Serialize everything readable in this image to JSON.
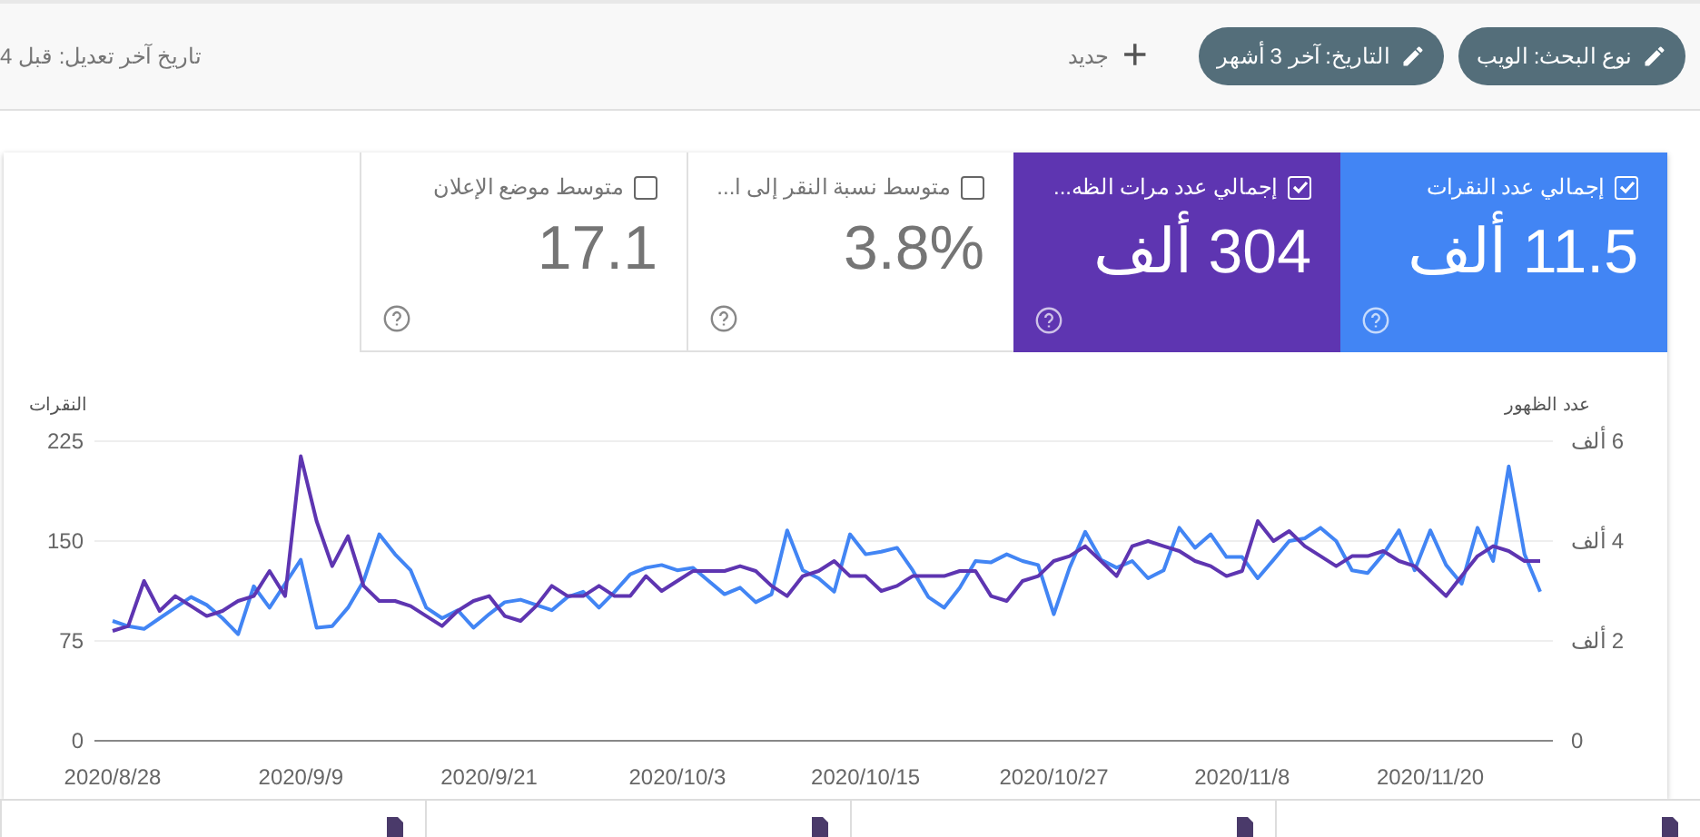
{
  "toolbar": {
    "chips": [
      {
        "label": "نوع البحث: الويب"
      },
      {
        "label": "التاريخ: آخر 3 أشهر"
      }
    ],
    "new_button": {
      "icon": "+",
      "label": "جديد"
    },
    "last_modified": "تاريخ آخر تعديل: قبل 4"
  },
  "metrics": [
    {
      "label": "إجمالي عدد النقرات",
      "value": "11.5 ألف",
      "checked": true,
      "color": "#4285f4"
    },
    {
      "label": "إجمالي عدد مرات الظه...",
      "value": "304 ألف",
      "checked": true,
      "color": "#5e35b1"
    },
    {
      "label": "متوسط نسبة النقر إلى ا...",
      "value": "3.8%",
      "checked": false
    },
    {
      "label": "متوسط موضع الإعلان",
      "value": "17.1",
      "checked": false
    }
  ],
  "chart": {
    "chart_data": {
      "type": "line",
      "ylabel": "النقرات",
      "y2label": "عدد الظهور",
      "ylim": [
        0,
        225
      ],
      "yticks": [
        0,
        75,
        150,
        225
      ],
      "y2lim": [
        0,
        6
      ],
      "y2ticks": [
        {
          "value": 0,
          "label": "0"
        },
        {
          "value": 2,
          "label": "2 ألف"
        },
        {
          "value": 4,
          "label": "4 ألف"
        },
        {
          "value": 6,
          "label": "6 ألف"
        }
      ],
      "categories": [
        "2020/8/28",
        null,
        null,
        null,
        null,
        null,
        null,
        null,
        null,
        null,
        null,
        null,
        "2020/9/9",
        null,
        null,
        null,
        null,
        null,
        null,
        null,
        null,
        null,
        null,
        null,
        "2020/9/21",
        null,
        null,
        null,
        null,
        null,
        null,
        null,
        null,
        null,
        null,
        null,
        "2020/10/3",
        null,
        null,
        null,
        null,
        null,
        null,
        null,
        null,
        null,
        null,
        null,
        "2020/10/15",
        null,
        null,
        null,
        null,
        null,
        null,
        null,
        null,
        null,
        null,
        null,
        "2020/10/27",
        null,
        null,
        null,
        null,
        null,
        null,
        null,
        null,
        null,
        null,
        null,
        "2020/11/8",
        null,
        null,
        null,
        null,
        null,
        null,
        null,
        null,
        null,
        null,
        null,
        "2020/11/20",
        null,
        null,
        null,
        null,
        null,
        null,
        null
      ],
      "series": [
        {
          "color": "#4285f4",
          "values": [
            90,
            86,
            84,
            92,
            100,
            108,
            102,
            92,
            80,
            116,
            100,
            118,
            136,
            85,
            86,
            100,
            120,
            155,
            140,
            128,
            100,
            92,
            98,
            85,
            95,
            104,
            106,
            102,
            98,
            108,
            112,
            100,
            112,
            125,
            130,
            132,
            128,
            130,
            120,
            110,
            115,
            104,
            110,
            158,
            128,
            122,
            112,
            155,
            140,
            142,
            145,
            128,
            108,
            100,
            115,
            135,
            134,
            140,
            135,
            132,
            95,
            130,
            157,
            136,
            130,
            135,
            122,
            128,
            160,
            145,
            155,
            138,
            138,
            122,
            136,
            150,
            152,
            160,
            150,
            128,
            126,
            140,
            158,
            128,
            158,
            132,
            118,
            160,
            135,
            206,
            140,
            112
          ]
        },
        {
          "color": "#5e35b1",
          "axis": "y2",
          "values": [
            2.2,
            2.3,
            3.2,
            2.6,
            2.9,
            2.7,
            2.5,
            2.6,
            2.8,
            2.9,
            3.4,
            2.9,
            5.7,
            4.4,
            3.5,
            4.1,
            3.1,
            2.8,
            2.8,
            2.7,
            2.5,
            2.3,
            2.6,
            2.8,
            2.9,
            2.5,
            2.4,
            2.7,
            3.1,
            2.9,
            2.9,
            3.1,
            2.9,
            2.9,
            3.3,
            3.0,
            3.2,
            3.4,
            3.4,
            3.4,
            3.5,
            3.4,
            3.1,
            2.9,
            3.3,
            3.4,
            3.6,
            3.3,
            3.3,
            3.0,
            3.1,
            3.3,
            3.3,
            3.3,
            3.4,
            3.4,
            2.9,
            2.8,
            3.2,
            3.3,
            3.6,
            3.7,
            3.9,
            3.6,
            3.3,
            3.9,
            4.0,
            3.9,
            3.8,
            3.6,
            3.5,
            3.3,
            3.4,
            4.4,
            4.0,
            4.2,
            3.9,
            3.7,
            3.5,
            3.7,
            3.7,
            3.8,
            3.6,
            3.5,
            3.2,
            2.9,
            3.3,
            3.7,
            3.9,
            3.8,
            3.6,
            3.6
          ]
        }
      ]
    }
  }
}
